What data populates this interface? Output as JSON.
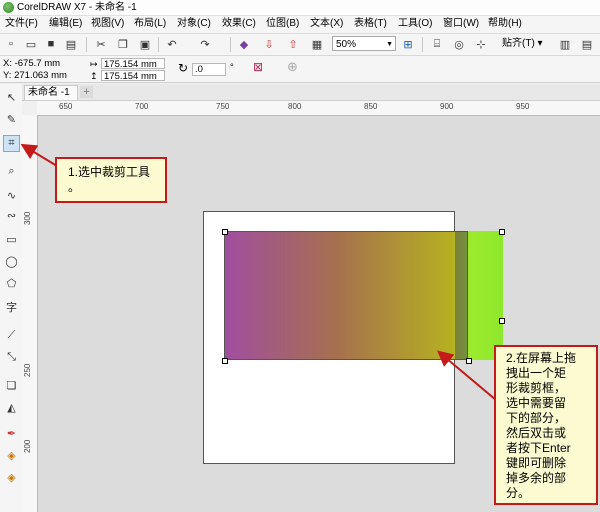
{
  "window": {
    "title": "CorelDRAW X7 - 未命名 -1"
  },
  "menu": [
    "文件(F)",
    "编辑(E)",
    "视图(V)",
    "布局(L)",
    "对象(C)",
    "效果(C)",
    "位图(B)",
    "文本(X)",
    "表格(T)",
    "工具(O)",
    "窗口(W)",
    "帮助(H)"
  ],
  "toolbar": {
    "zoom": "50%",
    "snap_label": "贴齐(T)"
  },
  "propbar": {
    "x": "X: -675.7 mm",
    "y": "Y: 271.063 mm",
    "width": "175.154 mm",
    "height": "175.154 mm",
    "angle": ".0",
    "degree": "°"
  },
  "tab": {
    "doc_name": "未命名 -1",
    "add": "+"
  },
  "ruler": {
    "top": [
      "650",
      "700",
      "750",
      "800",
      "850",
      "900",
      "950"
    ],
    "left": [
      "300",
      "250",
      "200"
    ]
  },
  "callouts": {
    "step1": "1.选中裁剪工具\n。",
    "step2": "2.在屏幕上拖\n拽出一个矩\n形裁剪框，\n选中需要留\n下的部分，\n然后双击或\n者按下Enter\n键即可删除\n掉多余的部\n分。"
  },
  "colors": {
    "callout_border": "#c51a1a",
    "callout_bg": "#fcfad0",
    "gradient_start": "#a04ea0",
    "gradient_end": "#8ee82c"
  },
  "icons": [
    "new-icon",
    "open-icon",
    "save-icon",
    "print-icon",
    "cut-icon",
    "copy-icon",
    "paste-icon",
    "undo-icon",
    "redo-icon",
    "import-icon",
    "export-icon",
    "publish-icon",
    "zoom-fit-icon",
    "crop-tool-icon"
  ]
}
